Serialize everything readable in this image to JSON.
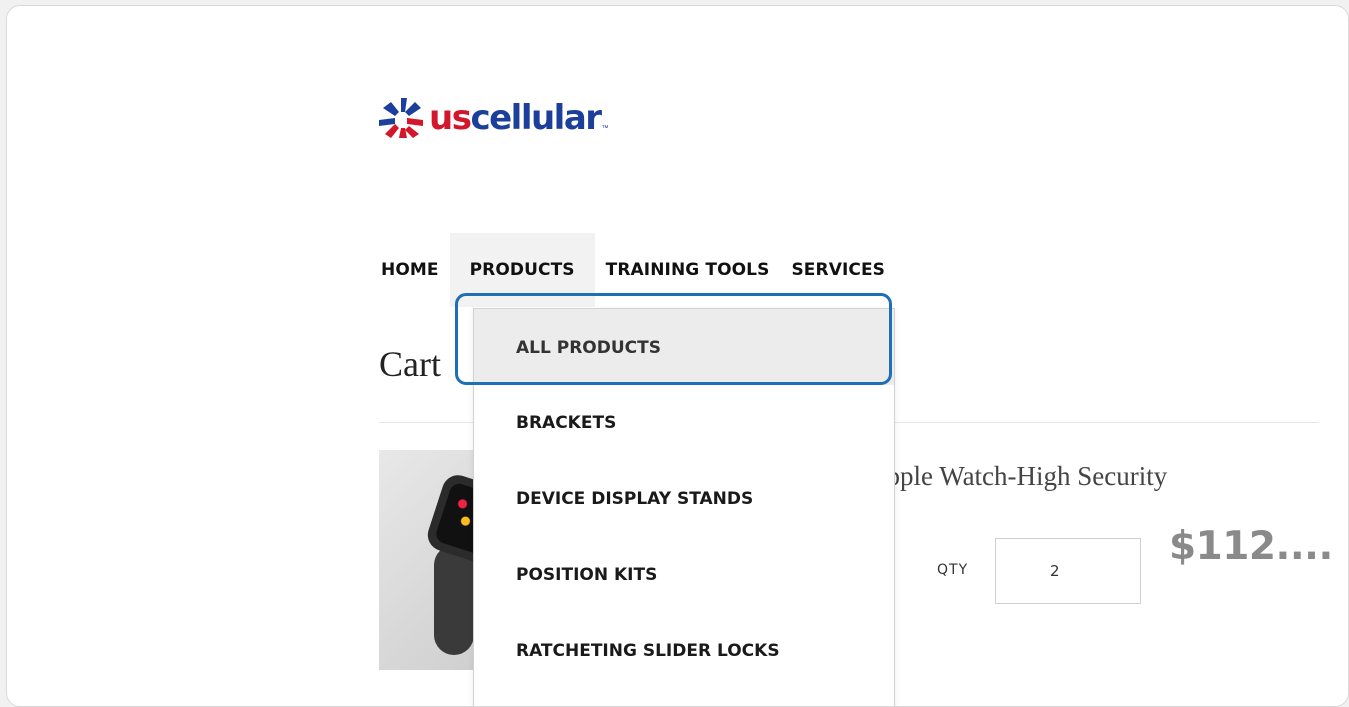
{
  "brand": {
    "name_prefix": "us",
    "name_suffix": "cellular",
    "trademark": "™",
    "icon": "star-burst-logo-icon",
    "colors": {
      "red": "#d3162b",
      "blue": "#1b3f9a"
    }
  },
  "nav": {
    "items": [
      {
        "label": "HOME"
      },
      {
        "label": "PRODUCTS"
      },
      {
        "label": "TRAINING TOOLS"
      },
      {
        "label": "SERVICES"
      }
    ],
    "active_label": "PRODUCTS"
  },
  "dropdown": {
    "items": [
      {
        "label": "ALL PRODUCTS"
      },
      {
        "label": "BRACKETS"
      },
      {
        "label": "DEVICE DISPLAY STANDS"
      },
      {
        "label": "POSITION KITS"
      },
      {
        "label": "RATCHETING SLIDER LOCKS"
      }
    ],
    "highlighted_label": "ALL PRODUCTS",
    "highlight_color": "#1f6fb5"
  },
  "page": {
    "title_visible": "Cart"
  },
  "cart": {
    "item": {
      "name_visible": "Apple Watch-High Security",
      "qty_label": "QTY",
      "qty_value": "2",
      "price_visible": "$112...."
    }
  }
}
